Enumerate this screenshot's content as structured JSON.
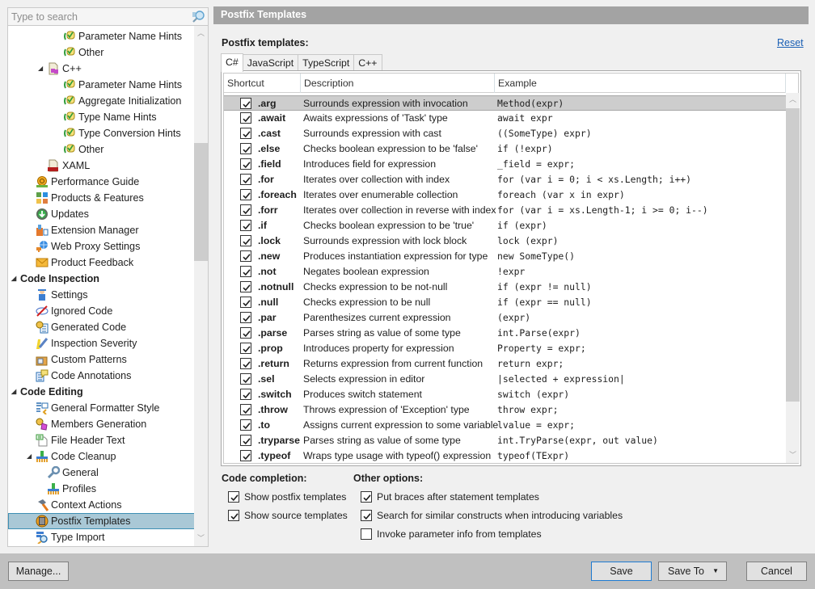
{
  "search": {
    "placeholder": "Type to search"
  },
  "tree": {
    "items": [
      {
        "label": "Parameter Name Hints",
        "indent": 4,
        "icon": "hint-icon",
        "bold": false,
        "arrow": ""
      },
      {
        "label": "Other",
        "indent": 4,
        "icon": "hint-icon",
        "bold": false,
        "arrow": ""
      },
      {
        "label": "C++",
        "indent": 3,
        "icon": "cpp-file-icon",
        "bold": false,
        "arrow": "◢"
      },
      {
        "label": "Parameter Name Hints",
        "indent": 4,
        "icon": "hint-icon",
        "bold": false,
        "arrow": ""
      },
      {
        "label": "Aggregate Initialization",
        "indent": 4,
        "icon": "hint-icon",
        "bold": false,
        "arrow": ""
      },
      {
        "label": "Type Name Hints",
        "indent": 4,
        "icon": "hint-icon",
        "bold": false,
        "arrow": ""
      },
      {
        "label": "Type Conversion Hints",
        "indent": 4,
        "icon": "hint-icon",
        "bold": false,
        "arrow": ""
      },
      {
        "label": "Other",
        "indent": 4,
        "icon": "hint-icon",
        "bold": false,
        "arrow": ""
      },
      {
        "label": "XAML",
        "indent": 3,
        "icon": "xaml-file-icon",
        "bold": false,
        "arrow": ""
      },
      {
        "label": "Performance Guide",
        "indent": 2,
        "icon": "performance-guide-icon",
        "bold": false,
        "arrow": ""
      },
      {
        "label": "Products & Features",
        "indent": 2,
        "icon": "products-features-icon",
        "bold": false,
        "arrow": ""
      },
      {
        "label": "Updates",
        "indent": 2,
        "icon": "updates-icon",
        "bold": false,
        "arrow": ""
      },
      {
        "label": "Extension Manager",
        "indent": 2,
        "icon": "extension-manager-icon",
        "bold": false,
        "arrow": ""
      },
      {
        "label": "Web Proxy Settings",
        "indent": 2,
        "icon": "web-proxy-icon",
        "bold": false,
        "arrow": ""
      },
      {
        "label": "Product Feedback",
        "indent": 2,
        "icon": "feedback-envelope-icon",
        "bold": false,
        "arrow": ""
      },
      {
        "label": "Code Inspection",
        "indent": 0,
        "icon": "",
        "bold": true,
        "arrow": "◢"
      },
      {
        "label": "Settings",
        "indent": 2,
        "icon": "inspection-settings-icon",
        "bold": false,
        "arrow": ""
      },
      {
        "label": "Ignored Code",
        "indent": 2,
        "icon": "ignored-code-icon",
        "bold": false,
        "arrow": ""
      },
      {
        "label": "Generated Code",
        "indent": 2,
        "icon": "generated-code-icon",
        "bold": false,
        "arrow": ""
      },
      {
        "label": "Inspection Severity",
        "indent": 2,
        "icon": "inspection-severity-icon",
        "bold": false,
        "arrow": ""
      },
      {
        "label": "Custom Patterns",
        "indent": 2,
        "icon": "custom-patterns-icon",
        "bold": false,
        "arrow": ""
      },
      {
        "label": "Code Annotations",
        "indent": 2,
        "icon": "code-annotations-icon",
        "bold": false,
        "arrow": ""
      },
      {
        "label": "Code Editing",
        "indent": 0,
        "icon": "",
        "bold": true,
        "arrow": "◢"
      },
      {
        "label": "General Formatter Style",
        "indent": 2,
        "icon": "formatter-style-icon",
        "bold": false,
        "arrow": ""
      },
      {
        "label": "Members Generation",
        "indent": 2,
        "icon": "members-generation-icon",
        "bold": false,
        "arrow": ""
      },
      {
        "label": "File Header Text",
        "indent": 2,
        "icon": "file-header-icon",
        "bold": false,
        "arrow": ""
      },
      {
        "label": "Code Cleanup",
        "indent": 2,
        "icon": "code-cleanup-broom-icon",
        "bold": false,
        "arrow": "◢"
      },
      {
        "label": "General",
        "indent": 3,
        "icon": "wrench-icon",
        "bold": false,
        "arrow": ""
      },
      {
        "label": "Profiles",
        "indent": 3,
        "icon": "code-cleanup-broom-icon",
        "bold": false,
        "arrow": ""
      },
      {
        "label": "Context Actions",
        "indent": 2,
        "icon": "hammer-icon",
        "bold": false,
        "arrow": ""
      },
      {
        "label": "Postfix Templates",
        "indent": 2,
        "icon": "postfix-templates-icon",
        "bold": false,
        "arrow": "",
        "selected": true
      },
      {
        "label": "Type Import",
        "indent": 2,
        "icon": "type-import-icon",
        "bold": false,
        "arrow": ""
      }
    ]
  },
  "header": {
    "title": "Postfix Templates"
  },
  "templates_label": "Postfix templates:",
  "reset_label": "Reset",
  "tabs": [
    {
      "label": "C#",
      "active": true
    },
    {
      "label": "JavaScript",
      "active": false
    },
    {
      "label": "TypeScript",
      "active": false
    },
    {
      "label": "C++",
      "active": false
    }
  ],
  "grid": {
    "columns": [
      "Shortcut",
      "Description",
      "Example"
    ],
    "rows": [
      {
        "checked": true,
        "shortcut": ".arg",
        "description": "Surrounds expression with invocation",
        "example": "Method(expr)",
        "selected": true
      },
      {
        "checked": true,
        "shortcut": ".await",
        "description": "Awaits expressions of 'Task' type",
        "example": "await expr"
      },
      {
        "checked": true,
        "shortcut": ".cast",
        "description": "Surrounds expression with cast",
        "example": "((SomeType) expr)"
      },
      {
        "checked": true,
        "shortcut": ".else",
        "description": "Checks boolean expression to be 'false'",
        "example": "if (!expr)"
      },
      {
        "checked": true,
        "shortcut": ".field",
        "description": "Introduces field for expression",
        "example": "_field = expr;"
      },
      {
        "checked": true,
        "shortcut": ".for",
        "description": "Iterates over collection with index",
        "example": "for (var i = 0; i < xs.Length; i++)"
      },
      {
        "checked": true,
        "shortcut": ".foreach",
        "description": "Iterates over enumerable collection",
        "example": "foreach (var x in expr)"
      },
      {
        "checked": true,
        "shortcut": ".forr",
        "description": "Iterates over collection in reverse with index",
        "example": "for (var i = xs.Length-1; i >= 0; i--)"
      },
      {
        "checked": true,
        "shortcut": ".if",
        "description": "Checks boolean expression to be 'true'",
        "example": "if (expr)"
      },
      {
        "checked": true,
        "shortcut": ".lock",
        "description": "Surrounds expression with lock block",
        "example": "lock (expr)"
      },
      {
        "checked": true,
        "shortcut": ".new",
        "description": "Produces instantiation expression for type",
        "example": "new SomeType()"
      },
      {
        "checked": true,
        "shortcut": ".not",
        "description": "Negates boolean expression",
        "example": "!expr"
      },
      {
        "checked": true,
        "shortcut": ".notnull",
        "description": "Checks expression to be not-null",
        "example": "if (expr != null)"
      },
      {
        "checked": true,
        "shortcut": ".null",
        "description": "Checks expression to be null",
        "example": "if (expr == null)"
      },
      {
        "checked": true,
        "shortcut": ".par",
        "description": "Parenthesizes current expression",
        "example": "(expr)"
      },
      {
        "checked": true,
        "shortcut": ".parse",
        "description": "Parses string as value of some type",
        "example": "int.Parse(expr)"
      },
      {
        "checked": true,
        "shortcut": ".prop",
        "description": "Introduces property for expression",
        "example": "Property = expr;"
      },
      {
        "checked": true,
        "shortcut": ".return",
        "description": "Returns expression from current function",
        "example": "return expr;"
      },
      {
        "checked": true,
        "shortcut": ".sel",
        "description": "Selects expression in editor",
        "example": "|selected + expression|"
      },
      {
        "checked": true,
        "shortcut": ".switch",
        "description": "Produces switch statement",
        "example": "switch (expr)"
      },
      {
        "checked": true,
        "shortcut": ".throw",
        "description": "Throws expression of 'Exception' type",
        "example": "throw expr;"
      },
      {
        "checked": true,
        "shortcut": ".to",
        "description": "Assigns current expression to some variable",
        "example": "lvalue = expr;"
      },
      {
        "checked": true,
        "shortcut": ".tryparse",
        "description": "Parses string as value of some type",
        "example": "int.TryParse(expr, out value)"
      },
      {
        "checked": true,
        "shortcut": ".typeof",
        "description": "Wraps type usage with typeof() expression",
        "example": "typeof(TExpr)"
      }
    ]
  },
  "code_completion": {
    "label": "Code completion:",
    "options": [
      {
        "label": "Show postfix templates",
        "checked": true
      },
      {
        "label": "Show source templates",
        "checked": true
      }
    ]
  },
  "other_options": {
    "label": "Other options:",
    "options": [
      {
        "label": "Put braces after statement templates",
        "checked": true
      },
      {
        "label": "Search for similar constructs when introducing variables",
        "checked": true
      },
      {
        "label": "Invoke parameter info from templates",
        "checked": false
      }
    ]
  },
  "buttons": {
    "manage": "Manage...",
    "save": "Save",
    "save_to": "Save To",
    "cancel": "Cancel"
  }
}
